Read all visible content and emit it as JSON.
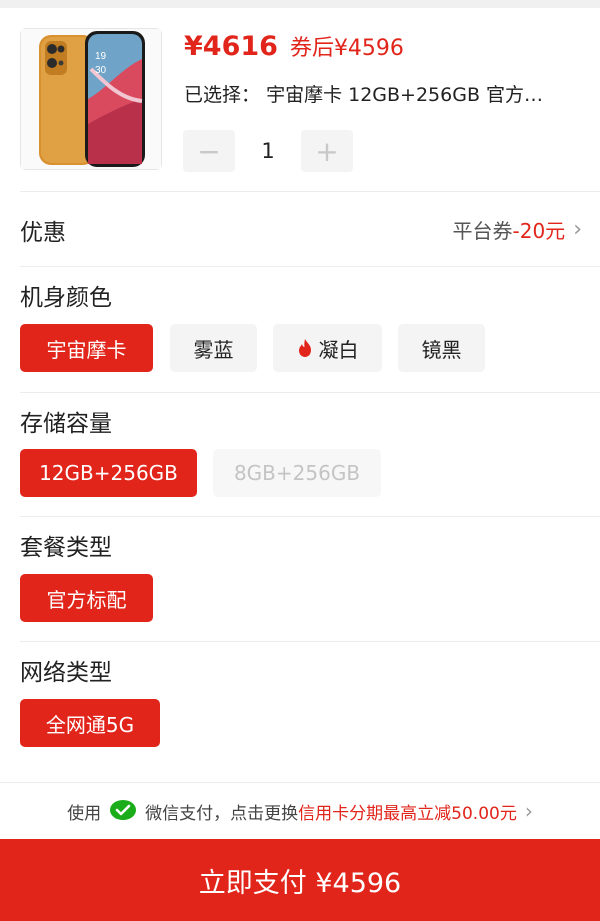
{
  "product": {
    "price": "¥4616",
    "price_after_coupon": "券后¥4596",
    "selected_label": "已选择：",
    "selected_value": "宇宙摩卡 12GB+256GB 官方…",
    "quantity": "1",
    "minus_symbol": "−",
    "plus_symbol": "+",
    "image_icon": "phone-product-image"
  },
  "coupon": {
    "label": "优惠",
    "prefix": "平台券",
    "amount": "-20元",
    "chevron": "›"
  },
  "sections": {
    "color": {
      "title": "机身颜色",
      "options": [
        "宇宙摩卡",
        "雾蓝",
        "凝白",
        "镜黑"
      ],
      "selected": "宇宙摩卡",
      "hot_option": "凝白"
    },
    "storage": {
      "title": "存储容量",
      "options": [
        "12GB+256GB",
        "8GB+256GB"
      ],
      "selected": "12GB+256GB",
      "disabled": "8GB+256GB"
    },
    "package": {
      "title": "套餐类型",
      "options": [
        "官方标配"
      ],
      "selected": "官方标配"
    },
    "network": {
      "title": "网络类型",
      "options": [
        "全网通5G"
      ],
      "selected": "全网通5G"
    }
  },
  "promo": {
    "prefix": "使用",
    "wechat_pay": "微信支付，点击更换",
    "highlight": "信用卡分期最高立减50.00元",
    "chevron": "›",
    "icon": "wechat-pay-icon"
  },
  "pay_button": {
    "label": "立即支付 ¥4596"
  },
  "colors": {
    "accent": "#e1251b",
    "chip_bg": "#f4f4f4",
    "divider": "#ececec"
  }
}
